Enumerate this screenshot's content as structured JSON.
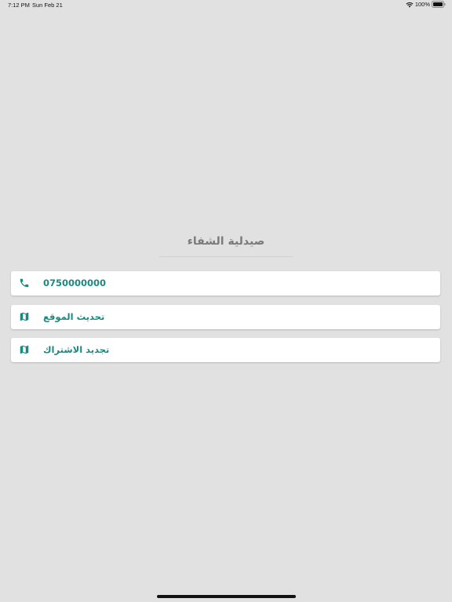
{
  "status_bar": {
    "time": "7:12 PM",
    "date": "Sun Feb 21",
    "battery": "100%",
    "wifi_icon": "wifi-icon",
    "battery_icon": "battery-icon"
  },
  "header": {
    "title": "صيدلية الشفاء"
  },
  "items": [
    {
      "label": "0750000000",
      "icon": "phone-icon"
    },
    {
      "label": "تحديث الموقع",
      "icon": "map-icon"
    },
    {
      "label": "تجديد الاشتراك",
      "icon": "map-icon"
    }
  ],
  "colors": {
    "background": "#e1e1e1",
    "accent": "#1a8a80",
    "title": "#7a7a7a",
    "card": "#ffffff"
  }
}
